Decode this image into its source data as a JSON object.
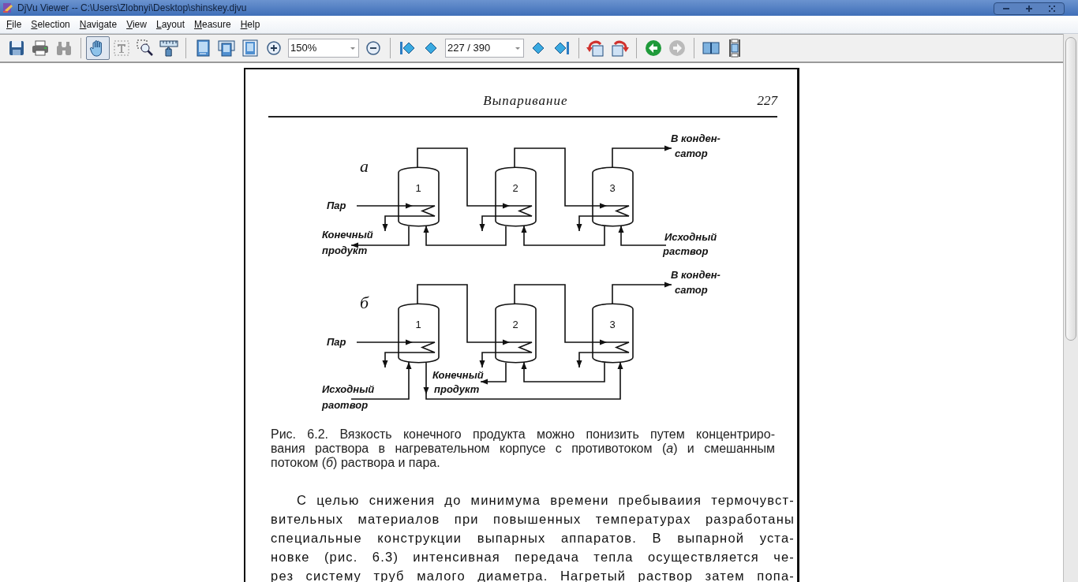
{
  "window": {
    "title": "DjVu Viewer -- C:\\Users\\Zlobnyi\\Desktop\\shinskey.djvu"
  },
  "menu": [
    "File",
    "Selection",
    "Navigate",
    "View",
    "Layout",
    "Measure",
    "Help"
  ],
  "toolbar": [
    {
      "kind": "save",
      "disabled": false
    },
    {
      "kind": "print",
      "disabled": false
    },
    {
      "kind": "find",
      "disabled": true
    },
    {
      "kind": "separator"
    },
    {
      "kind": "hand",
      "disabled": false,
      "selected": true
    },
    {
      "kind": "text-select",
      "disabled": true,
      "selected": false
    },
    {
      "kind": "zoom-rect",
      "disabled": false,
      "selected": false
    },
    {
      "kind": "ruler",
      "disabled": false,
      "selected": false
    },
    {
      "kind": "separator"
    },
    {
      "kind": "page-fit",
      "disabled": false
    },
    {
      "kind": "page-width",
      "disabled": false
    },
    {
      "kind": "page-actual",
      "disabled": false
    },
    {
      "kind": "zoom-in",
      "disabled": false
    },
    {
      "kind": "zoom-combo",
      "value": "150%"
    },
    {
      "kind": "zoom-out",
      "disabled": false
    },
    {
      "kind": "separator"
    },
    {
      "kind": "first",
      "disabled": false
    },
    {
      "kind": "prev",
      "disabled": false
    },
    {
      "kind": "page-combo",
      "value": "227 / 390"
    },
    {
      "kind": "next",
      "disabled": false
    },
    {
      "kind": "last",
      "disabled": false
    },
    {
      "kind": "separator"
    },
    {
      "kind": "rotate-left",
      "disabled": false
    },
    {
      "kind": "rotate-right",
      "disabled": false
    },
    {
      "kind": "separator"
    },
    {
      "kind": "back",
      "disabled": false
    },
    {
      "kind": "forward",
      "disabled": true
    },
    {
      "kind": "separator"
    },
    {
      "kind": "two-page",
      "disabled": false
    },
    {
      "kind": "continuous",
      "disabled": false
    }
  ],
  "page": {
    "running_head": "Выпаривание",
    "page_number": "227",
    "figures": [
      {
        "kind": "counterflow",
        "label": "а",
        "vessels": [
          "1",
          "2",
          "3"
        ],
        "steam": "Пар",
        "condenser": [
          "В конден-",
          "сатор"
        ],
        "product": [
          "Конечный",
          "продукт"
        ],
        "feed": [
          "Исходный",
          "раствор"
        ]
      },
      {
        "kind": "mixed",
        "label": "б",
        "vessels": [
          "1",
          "2",
          "3"
        ],
        "steam": "Пар",
        "condenser": [
          "В конден-",
          "сатор"
        ],
        "product": [
          "Конечный",
          "продукт"
        ],
        "feed": [
          "Исходный",
          "раотвор"
        ]
      }
    ],
    "caption": [
      "Рис. 6.2. Вязкость конечного продукта можно понизить путем концентриро-",
      "вания раствора в нагревательном корпусе с противотоком (*а*) и смешанным",
      "потоком (*б*) раствора и пара."
    ],
    "body": [
      "С целью снижения до минимума времени пребываиия термочувст-",
      "вительных материалов при повышенных температурах разработаны",
      "специальные конструкции выпарных аппаратов. В выпарной уста-",
      "новке (рис. 6.3) интенсивная передача тепла осуществляется че-",
      "рез систему труб малого диаметра. Нагретый раствор затем попа-"
    ]
  }
}
